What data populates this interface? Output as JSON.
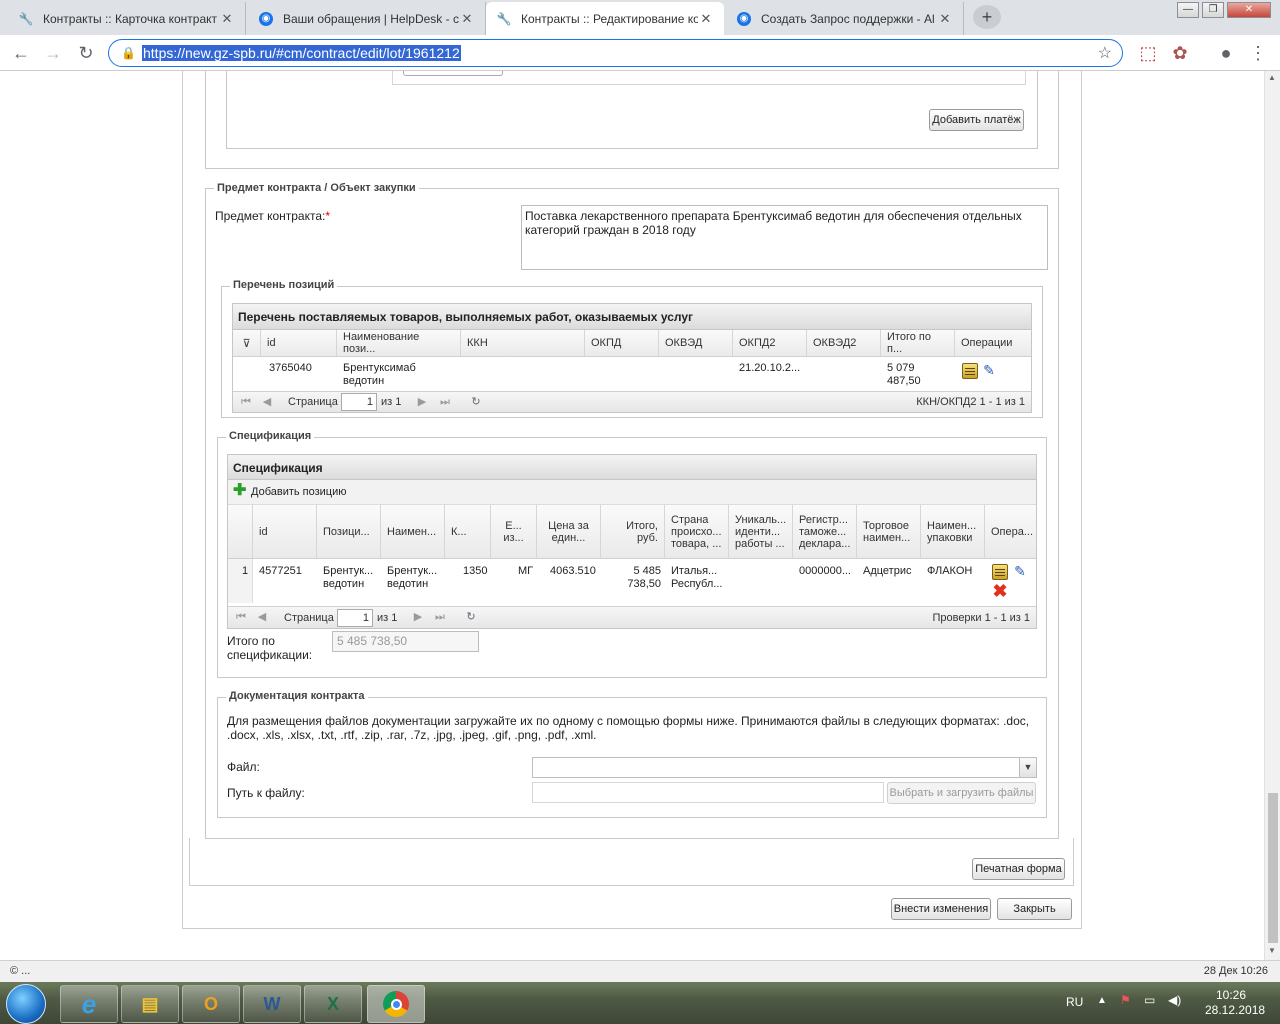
{
  "browser": {
    "tabs": [
      {
        "title": "Контракты :: Карточка контракт",
        "icon": "wrench-icon",
        "active": false
      },
      {
        "title": "Ваши обращения | HelpDesk - с",
        "icon": "globe-icon",
        "active": false
      },
      {
        "title": "Контракты :: Редактирование ко",
        "icon": "wrench-icon",
        "active": true
      },
      {
        "title": "Создать Запрос поддержки - Al",
        "icon": "globe-icon",
        "active": false
      }
    ],
    "url": "https://new.gz-spb.ru/#cm/contract/edit/lot/1961212",
    "new_tab": "+",
    "win_controls": {
      "minimize": "—",
      "maximize": "❐",
      "close": "✕"
    }
  },
  "payments": {
    "add_payment_button": "Добавить платёж"
  },
  "subject_section": {
    "legend": "Предмет контракта / Объект закупки",
    "subject_label": "Предмет контракта:",
    "required_mark": "*",
    "subject_value": "Поставка лекарственного препарата Брентуксимаб ведотин для обеспечения отдельных категорий граждан в 2018 году"
  },
  "positions": {
    "legend": "Перечень позиций",
    "grid_title": "Перечень поставляемых товаров, выполняемых работ, оказываемых услуг",
    "columns": [
      "id",
      "Наименование пози...",
      "ККН",
      "ОКПД",
      "ОКВЭД",
      "ОКПД2",
      "ОКВЭД2",
      "Итого по п...",
      "Операции"
    ],
    "rows": [
      {
        "id": "3765040",
        "name_l1": "Брентуксимаб",
        "name_l2": "ведотин",
        "kkn": "",
        "okpd": "",
        "okved": "",
        "okpd2": "21.20.10.2...",
        "okved2": "",
        "total_l1": "5 079",
        "total_l2": "487,50"
      }
    ],
    "pager": {
      "page_label": "Страница",
      "page": "1",
      "of": "из 1",
      "summary": "ККН/ОКПД2 1 - 1 из 1"
    }
  },
  "specification": {
    "legend": "Спецификация",
    "grid_title": "Спецификация",
    "add_position": "Добавить позицию",
    "columns": [
      [
        "id"
      ],
      [
        "Позици..."
      ],
      [
        "Наимен..."
      ],
      [
        "К..."
      ],
      [
        "Е...",
        "из..."
      ],
      [
        "Цена за",
        "един..."
      ],
      [
        "Итого,",
        "руб."
      ],
      [
        "Страна",
        "происхо...",
        "товара, ..."
      ],
      [
        "Уникаль...",
        "иденти...",
        "работы ..."
      ],
      [
        "Регистр...",
        "таможе...",
        "деклара..."
      ],
      [
        "Торговое",
        "наимен..."
      ],
      [
        "Наимен...",
        "упаковки"
      ],
      [
        "Опера..."
      ]
    ],
    "rows": [
      {
        "num": "1",
        "id": "4577251",
        "pos_l1": "Брентук...",
        "pos_l2": "ведотин",
        "name_l1": "Брентук...",
        "name_l2": "ведотин",
        "qty": "1350",
        "unit": "МГ",
        "price": "4063.510",
        "total_l1": "5 485",
        "total_l2": "738,50",
        "country_l1": "Италья...",
        "country_l2": "Республ...",
        "uid": "",
        "decl": "0000000...",
        "trade": "Адцетрис",
        "pack": "ФЛАКОН"
      }
    ],
    "pager": {
      "page_label": "Страница",
      "page": "1",
      "of": "из 1",
      "summary": "Проверки 1 - 1 из 1"
    },
    "total_label_l1": "Итого по",
    "total_label_l2": "спецификации:",
    "total_value": "5 485 738,50"
  },
  "documents": {
    "legend": "Документация контракта",
    "description": "Для размещения файлов документации загружайте их по одному с помощью формы ниже. Принимаются файлы в следующих форматах: .doc, .docx, .xls, .xlsx, .txt, .rtf, .zip, .rar, .7z, .jpg, .jpeg, .gif, .png, .pdf, .xml.",
    "file_label": "Файл:",
    "path_label": "Путь к файлу:",
    "upload_button": "Выбрать и загрузить файлы"
  },
  "actions": {
    "print_form": "Печатная форма",
    "apply_changes": "Внести изменения",
    "close": "Закрыть"
  },
  "statusbar": {
    "left": "© ...",
    "right": "28 Дек 10:26"
  },
  "taskbar": {
    "lang": "RU",
    "time": "10:26",
    "date": "28.12.2018"
  }
}
